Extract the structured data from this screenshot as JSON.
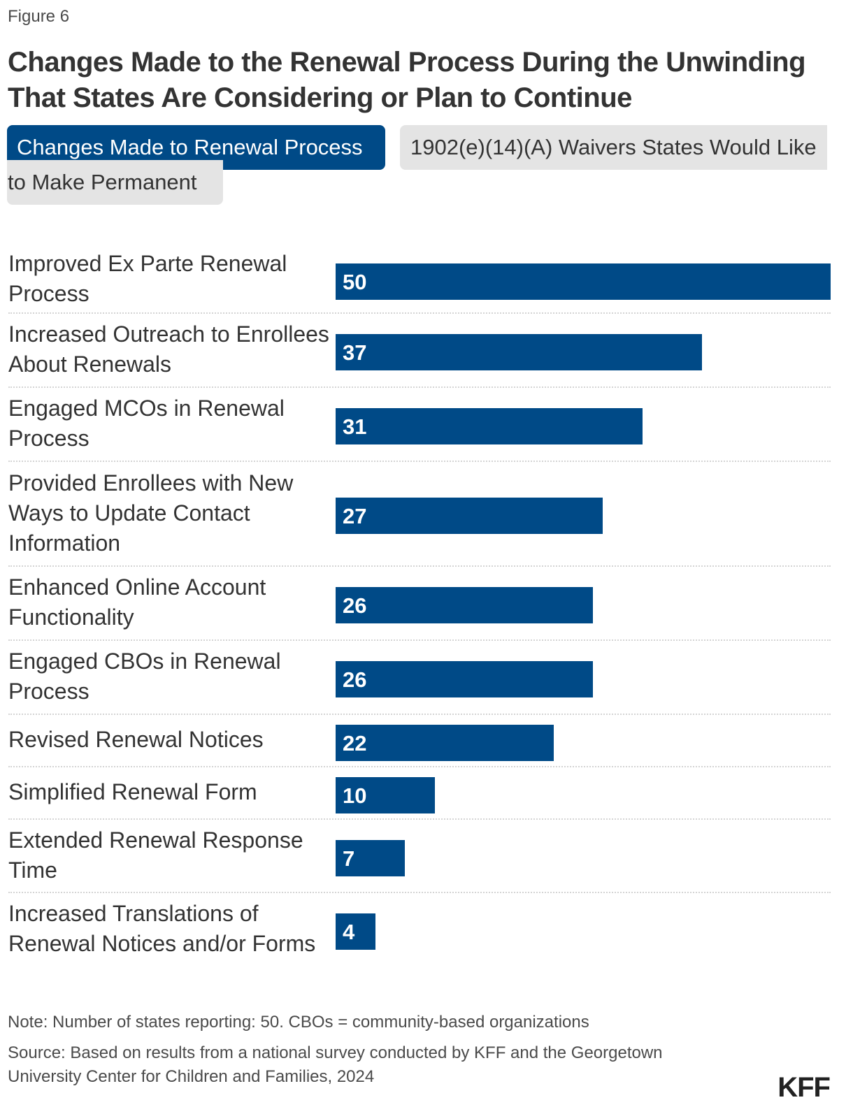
{
  "figure_label": "Figure 6",
  "title": "Changes Made to the Renewal Process During the Unwinding That States Are Considering or Plan to Continue",
  "tabs": [
    {
      "label": "Changes Made to Renewal Process",
      "active": true
    },
    {
      "label_line1": "1902(e)(14)(A) Waivers States Would Like",
      "label_line2": "to Make Permanent",
      "active": false
    }
  ],
  "colors": {
    "bar": "#004A87",
    "tab_active": "#004A87",
    "tab_inactive": "#e4e4e4"
  },
  "chart_data": {
    "type": "bar",
    "orientation": "horizontal",
    "title": "Changes Made to the Renewal Process During the Unwinding That States Are Considering or Plan to Continue",
    "xlabel": "",
    "ylabel": "",
    "xlim": [
      0,
      50
    ],
    "grid": false,
    "legend": "none",
    "categories": [
      "Improved Ex Parte Renewal Process",
      "Increased Outreach to Enrollees About Renewals",
      "Engaged MCOs in Renewal Process",
      "Provided Enrollees with New Ways to Update Contact Information",
      "Enhanced Online Account Functionality",
      "Engaged CBOs in Renewal Process",
      "Revised Renewal Notices",
      "Simplified Renewal Form",
      "Extended Renewal Response Time",
      "Increased Translations of Renewal Notices and/or Forms"
    ],
    "values": [
      50,
      37,
      31,
      27,
      26,
      26,
      22,
      10,
      7,
      4
    ],
    "data_labels": [
      "50",
      "37",
      "31",
      "27",
      "26",
      "26",
      "22",
      "10",
      "7",
      "4"
    ]
  },
  "note": "Note: Number of states reporting: 50. CBOs = community-based organizations",
  "source": "Source: Based on results from a national survey conducted by KFF and the Georgetown University Center for Children and Families, 2024",
  "logo": "KFF"
}
